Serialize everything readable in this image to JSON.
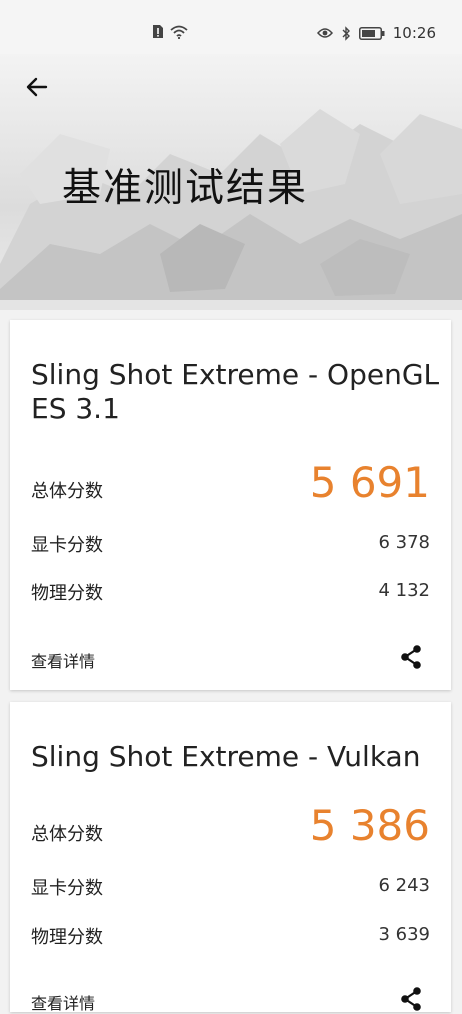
{
  "status_bar": {
    "time": "10:26",
    "icons": [
      "sim-alert-icon",
      "wifi-icon",
      "eye-icon",
      "bluetooth-icon",
      "battery-icon"
    ]
  },
  "header": {
    "title": "基准测试结果",
    "back_icon": "arrow-left-icon"
  },
  "results": [
    {
      "title": "Sling Shot Extreme - OpenGL ES 3.1",
      "total_label": "总体分数",
      "total_value": "5 691",
      "graphics_label": "显卡分数",
      "graphics_value": "6 378",
      "physics_label": "物理分数",
      "physics_value": "4 132",
      "details_label": "查看详情",
      "share_icon": "share-icon"
    },
    {
      "title": "Sling Shot Extreme - Vulkan",
      "total_label": "总体分数",
      "total_value": "5 386",
      "graphics_label": "显卡分数",
      "graphics_value": "6 243",
      "physics_label": "物理分数",
      "physics_value": "3 639",
      "details_label": "查看详情",
      "share_icon": "share-icon"
    }
  ],
  "colors": {
    "accent": "#e8822e",
    "background": "#f2f2f2",
    "card": "#ffffff"
  }
}
